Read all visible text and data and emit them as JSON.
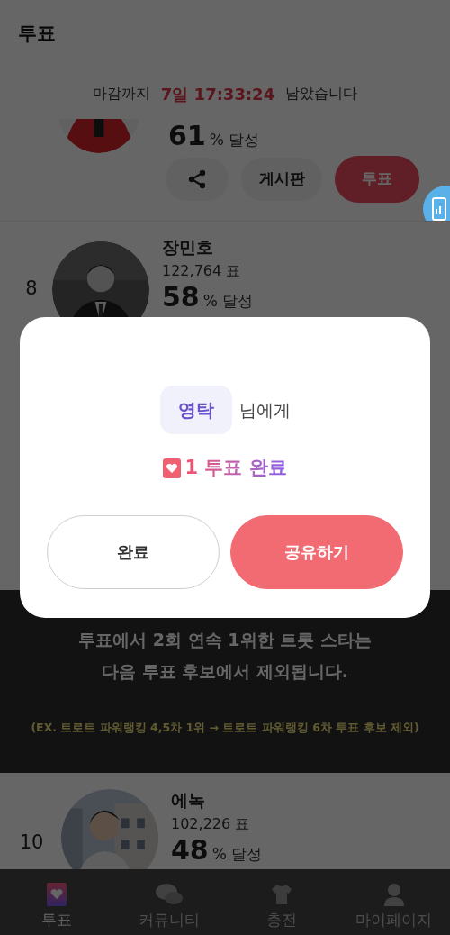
{
  "header": {
    "title": "투표"
  },
  "countdown": {
    "prefix": "마감까지",
    "time": "7일 17:33:24",
    "suffix": "남았습니다"
  },
  "top_card": {
    "percent": "61",
    "percent_label": "% 달성",
    "buttons": [
      {
        "kind": "share"
      },
      {
        "kind": "board",
        "label": "게시판"
      },
      {
        "kind": "vote",
        "label": "투표"
      }
    ]
  },
  "candidates": [
    {
      "rank": "8",
      "name": "장민호",
      "votes": "122,764 표",
      "percent": "58",
      "percent_label": "% 달성"
    },
    {
      "rank": "10",
      "name": "에녹",
      "votes": "102,226 표",
      "percent": "48",
      "percent_label": "% 달성"
    }
  ],
  "notice": {
    "lines": [
      "투표에서 2회 연속 1위한 트롯 스타는",
      "다음 투표 후보에서 제외됩니다."
    ],
    "example": "(EX.  트로트 파워랭킹 4,5차 1위 → 트로트 파워랭킹 6차 투표 후보 제외)"
  },
  "bottom_nav": [
    {
      "label": "투표",
      "kind": "vote",
      "selected": true
    },
    {
      "label": "커뮤니티",
      "kind": "community",
      "selected": false
    },
    {
      "label": "충전",
      "kind": "charge",
      "selected": false
    },
    {
      "label": "마이페이지",
      "kind": "mypage",
      "selected": false
    }
  ],
  "modal": {
    "recipient": "영탁",
    "recipient_suffix": "님에게",
    "result": "1 투표 완료",
    "buttons": [
      {
        "label": "완료",
        "kind": "secondary"
      },
      {
        "label": "공유하기",
        "kind": "primary"
      }
    ]
  }
}
